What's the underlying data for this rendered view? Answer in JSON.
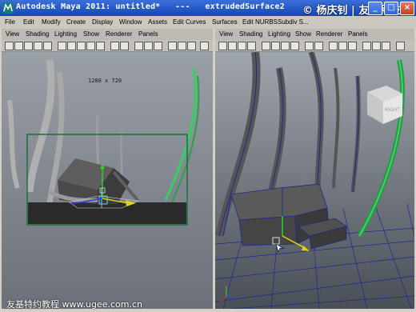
{
  "window": {
    "title": "Autodesk Maya 2011: untitled*   ---   extrudedSurface2",
    "watermark_top": "© 杨庆钊 | 友基科技",
    "controls": [
      "_",
      "□",
      "×"
    ]
  },
  "menubar": [
    "File",
    "Edit",
    "Modify",
    "Create",
    "Display",
    "Window",
    "Assets",
    "Edit Curves",
    "Surfaces",
    "Edit NURBS",
    "Subdiv S..."
  ],
  "left_panel": {
    "menu": [
      "View",
      "Shading",
      "Lighting",
      "Show",
      "Renderer",
      "Panels"
    ],
    "resolution_gate": "1280 x 720"
  },
  "right_panel": {
    "menu": [
      "View",
      "Shading",
      "Lighting",
      "Show",
      "Renderer",
      "Panels"
    ],
    "viewcube_label": "RIGHT"
  },
  "watermark_bottom": "友基特约教程 www.ugee.com.cn",
  "colors": {
    "title_bar": "#1a4fc0",
    "viewport_bg": "#8a9099",
    "nurbs_curve": "#38d060",
    "wire": "#1c2a8c"
  }
}
